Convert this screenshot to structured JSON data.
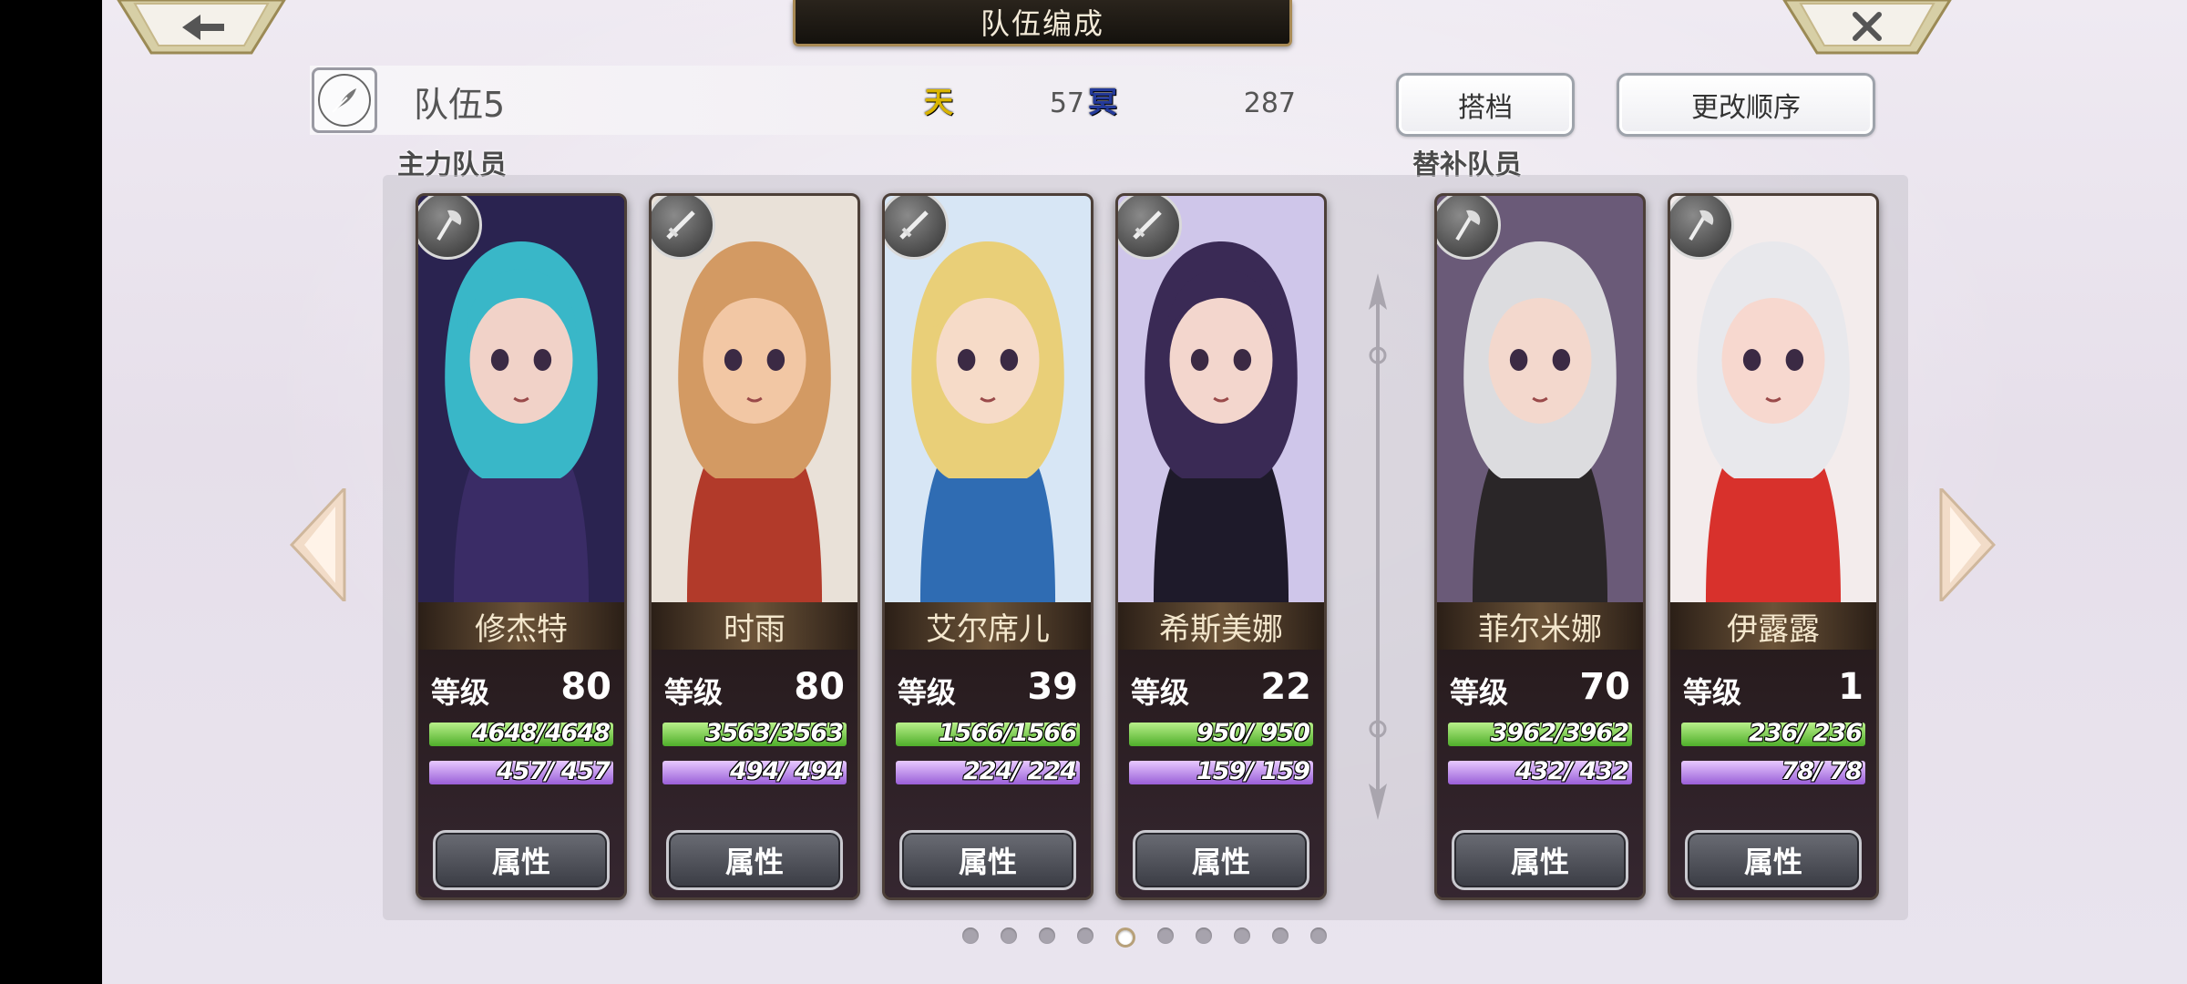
{
  "header": {
    "title": "队伍编成"
  },
  "team": {
    "name": "队伍5",
    "res1_icon": "天",
    "res1_value": "57",
    "res2_icon": "冥",
    "res2_value": "287"
  },
  "buttons": {
    "partner": "搭档",
    "order": "更改顺序"
  },
  "sections": {
    "main": "主力队员",
    "sub": "替补队员"
  },
  "members": [
    {
      "name": "修杰特",
      "level_label": "等级",
      "level": "80",
      "hp": "4648/4648",
      "mp": "457/ 457",
      "hp_ratio": 1.0,
      "mp_ratio": 1.0,
      "attr": "属性",
      "weapon": "axe-icon"
    },
    {
      "name": "时雨",
      "level_label": "等级",
      "level": "80",
      "hp": "3563/3563",
      "mp": "494/ 494",
      "hp_ratio": 1.0,
      "mp_ratio": 1.0,
      "attr": "属性",
      "weapon": "sword-icon"
    },
    {
      "name": "艾尔席儿",
      "level_label": "等级",
      "level": "39",
      "hp": "1566/1566",
      "mp": "224/ 224",
      "hp_ratio": 1.0,
      "mp_ratio": 1.0,
      "attr": "属性",
      "weapon": "sword-icon"
    },
    {
      "name": "希斯美娜",
      "level_label": "等级",
      "level": "22",
      "hp": "950/ 950",
      "mp": "159/ 159",
      "hp_ratio": 1.0,
      "mp_ratio": 1.0,
      "attr": "属性",
      "weapon": "sword-icon"
    },
    {
      "name": "菲尔米娜",
      "level_label": "等级",
      "level": "70",
      "hp": "3962/3962",
      "mp": "432/ 432",
      "hp_ratio": 1.0,
      "mp_ratio": 1.0,
      "attr": "属性",
      "weapon": "axe-icon"
    },
    {
      "name": "伊露露",
      "level_label": "等级",
      "level": "1",
      "hp": "236/ 236",
      "mp": "78/ 78",
      "hp_ratio": 1.0,
      "mp_ratio": 1.0,
      "attr": "属性",
      "weapon": "axe-icon"
    }
  ],
  "pagination": {
    "total": 10,
    "active": 5
  },
  "colors": {
    "hp_bar": "#6cc83a",
    "mp_bar": "#b885ea",
    "gold_trim": "#a88a55"
  }
}
